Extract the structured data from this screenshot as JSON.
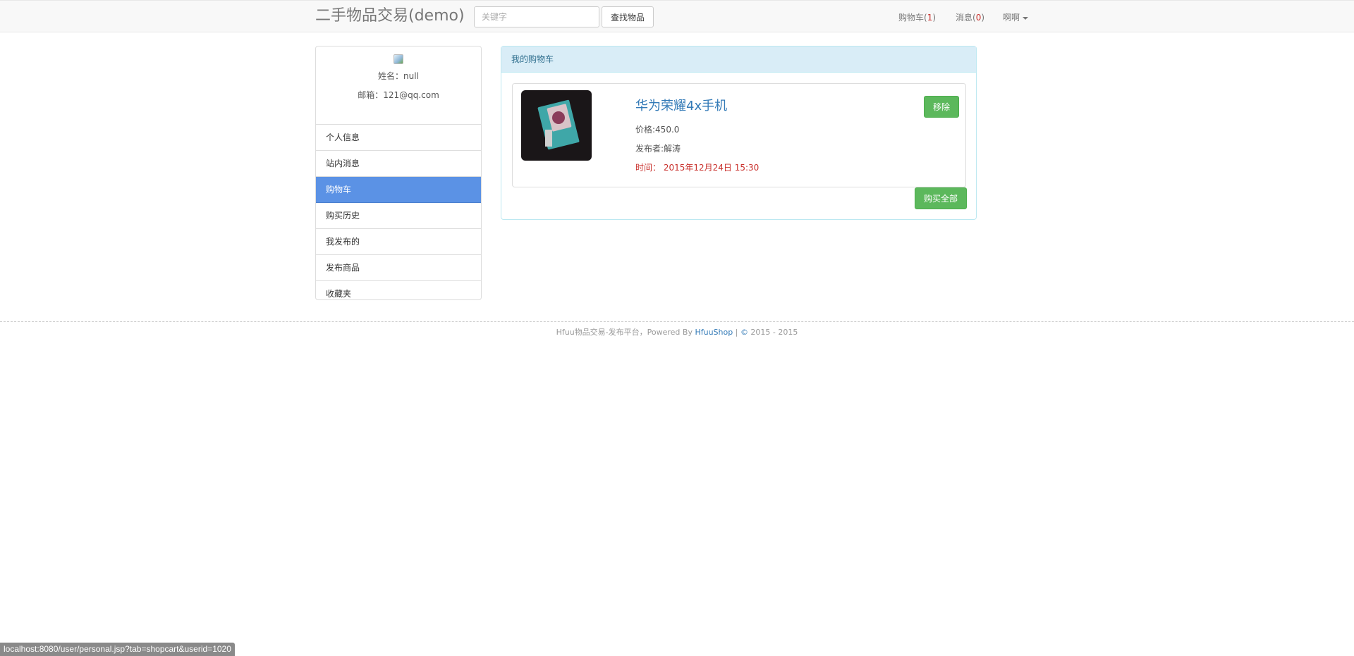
{
  "navbar": {
    "brand": "二手物品交易(demo)",
    "search_placeholder": "关键字",
    "search_button": "查找物品",
    "cart_label": "购物车(",
    "cart_count": "1",
    "messages_label": "消息(",
    "messages_count": "0",
    "close_paren": ")",
    "user_menu": "啊啊"
  },
  "profile": {
    "name_line": "姓名：null",
    "email_line": "邮箱：121@qq.com"
  },
  "sidebar": {
    "items": [
      {
        "label": "个人信息"
      },
      {
        "label": "站内消息"
      },
      {
        "label": "购物车"
      },
      {
        "label": "购买历史"
      },
      {
        "label": "我发布的"
      },
      {
        "label": "发布商品"
      },
      {
        "label": "收藏夹"
      }
    ]
  },
  "cart": {
    "heading": "我的购物车",
    "item": {
      "title": "华为荣耀4x手机",
      "price": "价格:450.0",
      "publisher": "发布者:解涛",
      "time": "时间： 2015年12月24日 15:30",
      "remove_button": "移除"
    },
    "buy_all_button": "购买全部"
  },
  "footer": {
    "text": "Hfuu物品交易-发布平台，Powered By ",
    "link": "HfuuShop",
    "sep": " | ",
    "copy_symbol": "©",
    "years": " 2015 - 2015"
  },
  "statusbar": {
    "url": "localhost:8080/user/personal.jsp?tab=shopcart&userid=1020"
  },
  "colors": {
    "active_menu": "#5b92e5",
    "success": "#5cb85c",
    "link": "#337ab7",
    "danger": "#c9302c",
    "panel_heading_bg": "#d9edf7"
  }
}
